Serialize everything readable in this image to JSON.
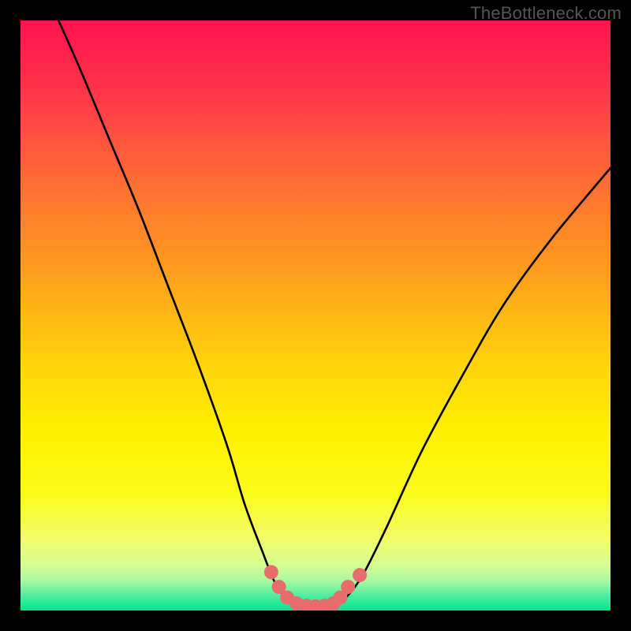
{
  "watermark": "TheBottleneck.com",
  "colors": {
    "black": "#000000",
    "curve": "#000000",
    "marker": "#e86c6c",
    "watermark": "#555555"
  },
  "chart_data": {
    "type": "line",
    "title": "",
    "xlabel": "",
    "ylabel": "",
    "xlim": [
      0,
      100
    ],
    "ylim": [
      0,
      100
    ],
    "gradient_stops": [
      {
        "offset": 0.0,
        "color": "#ff1450"
      },
      {
        "offset": 0.1,
        "color": "#ff2e4a"
      },
      {
        "offset": 0.2,
        "color": "#ff5240"
      },
      {
        "offset": 0.3,
        "color": "#ff7630"
      },
      {
        "offset": 0.4,
        "color": "#ff9522"
      },
      {
        "offset": 0.5,
        "color": "#ffb814"
      },
      {
        "offset": 0.6,
        "color": "#ffd80a"
      },
      {
        "offset": 0.7,
        "color": "#fff000"
      },
      {
        "offset": 0.8,
        "color": "#fbfb1a"
      },
      {
        "offset": 0.88,
        "color": "#f2fd6a"
      },
      {
        "offset": 0.92,
        "color": "#d8fd90"
      },
      {
        "offset": 0.95,
        "color": "#a8f9a0"
      },
      {
        "offset": 0.975,
        "color": "#50eda0"
      },
      {
        "offset": 1.0,
        "color": "#00e58f"
      }
    ],
    "series": [
      {
        "name": "bottleneck-curve",
        "x": [
          6,
          10,
          15,
          20,
          25,
          30,
          35,
          38,
          41,
          43,
          45,
          47,
          49,
          51,
          53,
          55,
          58,
          62,
          68,
          75,
          82,
          90,
          100
        ],
        "y": [
          101,
          92,
          80,
          68,
          55,
          42,
          28,
          18,
          10,
          5,
          2,
          0.8,
          0.5,
          0.5,
          0.8,
          2,
          6,
          14,
          27,
          40,
          52,
          63,
          75
        ]
      }
    ],
    "markers": {
      "name": "highlight-points",
      "color": "#e86c6c",
      "points": [
        {
          "x": 42.5,
          "y": 6.5
        },
        {
          "x": 43.8,
          "y": 4.0
        },
        {
          "x": 45.2,
          "y": 2.2
        },
        {
          "x": 46.8,
          "y": 1.2
        },
        {
          "x": 48.5,
          "y": 0.8
        },
        {
          "x": 50.0,
          "y": 0.7
        },
        {
          "x": 51.5,
          "y": 0.8
        },
        {
          "x": 53.0,
          "y": 1.2
        },
        {
          "x": 54.2,
          "y": 2.2
        },
        {
          "x": 55.5,
          "y": 4.0
        },
        {
          "x": 57.5,
          "y": 6.0
        }
      ]
    }
  }
}
